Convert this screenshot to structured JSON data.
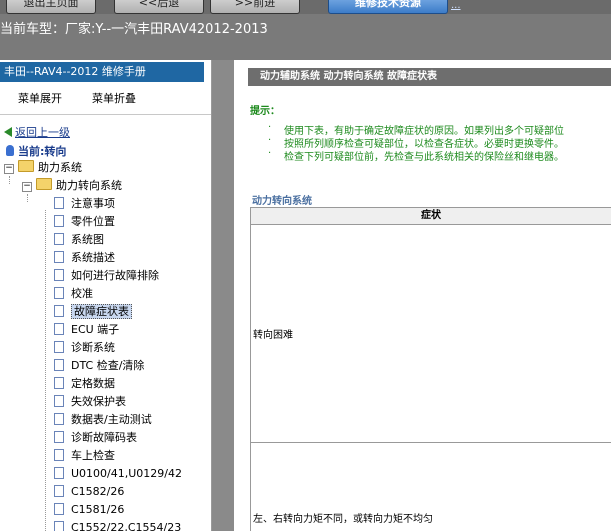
{
  "top_nav": {
    "btn1": "退出主页面",
    "btn2": "<<后退",
    "btn3": ">>前进",
    "btn4": "维修技术资源",
    "link_dots": "..."
  },
  "vehicle_line": "当前车型：厂家:Y--一汽丰田RAV42012-2013",
  "sidebar": {
    "title": "丰田--RAV4--2012 维修手册",
    "expand": "菜单展开",
    "collapse": "菜单折叠",
    "back_link": "返回上一级",
    "current": "当前:转向",
    "root": "助力系统",
    "sub": "助力转向系统",
    "items": [
      "注意事项",
      "零件位置",
      "系统图",
      "系统描述",
      "如何进行故障排除",
      "校准",
      "故障症状表",
      "ECU 端子",
      "诊断系统",
      "DTC 检查/清除",
      "定格数据",
      "失效保护表",
      "数据表/主动测试",
      "诊断故障码表",
      "车上检查",
      "U0100/41,U0129/42",
      "C1582/26",
      "C1581/26",
      "C1552/22,C1554/23"
    ],
    "selected_index": 6
  },
  "content": {
    "header": "动力辅助系统  动力转向系统  故障症状表",
    "hint_label": "提示：",
    "hints": [
      "使用下表，有助于确定故障症状的原因。如果列出多个可疑部位",
      "按照所列顺序检查可疑部位，以检查各症状。必要时更换零件。",
      "检查下列可疑部位前，先检查与此系统相关的保险丝和继电器。"
    ],
    "section": "动力转向系统",
    "table_header": "症状",
    "rows": [
      "转向困难",
      "左、右转向力矩不同，或转向力矩不均匀"
    ]
  }
}
